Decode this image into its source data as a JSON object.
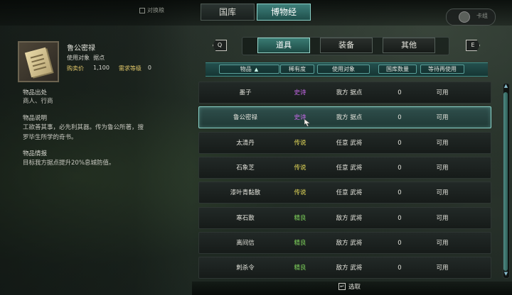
{
  "colors": {
    "legendary": "#e9de5a",
    "epic": "#c468e6",
    "fine": "#7fd35c",
    "accent": "#3f8a84"
  },
  "top": {
    "left_label": "对换粮",
    "right_label": "卡组"
  },
  "main_tabs": [
    {
      "label": "国库"
    },
    {
      "label": "博物经"
    }
  ],
  "detail": {
    "name": "鲁公密禄",
    "target_label": "使用对象",
    "target_value": "据点",
    "price_label": "购卖价",
    "price_value": "1,100",
    "level_label": "需求等级",
    "level_value": "0",
    "origin_title": "物品出处",
    "origin_text": "商人、行商",
    "desc_title": "物品说明",
    "desc_line1": "工欲善其事，必先利其器。传为鲁公所著，搜",
    "desc_line2": "罗毕生所学的奇书。",
    "info_title": "物品情报",
    "info_text": "目标我方据点提升20%息城防值。"
  },
  "sub_tabs": [
    {
      "label": "道具"
    },
    {
      "label": "装备"
    },
    {
      "label": "其他"
    }
  ],
  "keys": {
    "prev": "Q",
    "next": "E",
    "confirm": "↵"
  },
  "table": {
    "headers": [
      "物品",
      "稀有度",
      "使用对象",
      "国库数量",
      "等待再使用"
    ],
    "rows": [
      {
        "name": "墨子",
        "rarity": "史诗",
        "rarity_color": "#c468e6",
        "target": "我方 据点",
        "qty": "0",
        "status": "可用"
      },
      {
        "name": "鲁公密禄",
        "rarity": "史诗",
        "rarity_color": "#c468e6",
        "target": "我方 据点",
        "qty": "0",
        "status": "可用"
      },
      {
        "name": "太清丹",
        "rarity": "传说",
        "rarity_color": "#e9de5a",
        "target": "任意 武将",
        "qty": "0",
        "status": "可用"
      },
      {
        "name": "石象芝",
        "rarity": "传说",
        "rarity_color": "#e9de5a",
        "target": "任意 武将",
        "qty": "0",
        "status": "可用"
      },
      {
        "name": "漆叶青黏散",
        "rarity": "传说",
        "rarity_color": "#e9de5a",
        "target": "任意 武将",
        "qty": "0",
        "status": "可用"
      },
      {
        "name": "寒石散",
        "rarity": "精良",
        "rarity_color": "#7fd35c",
        "target": "敌方 武将",
        "qty": "0",
        "status": "可用"
      },
      {
        "name": "离间信",
        "rarity": "精良",
        "rarity_color": "#7fd35c",
        "target": "敌方 武将",
        "qty": "0",
        "status": "可用"
      },
      {
        "name": "刺杀令",
        "rarity": "精良",
        "rarity_color": "#7fd35c",
        "target": "敌方 武将",
        "qty": "0",
        "status": "可用"
      }
    ]
  },
  "bottom": {
    "select_label": "选取"
  }
}
